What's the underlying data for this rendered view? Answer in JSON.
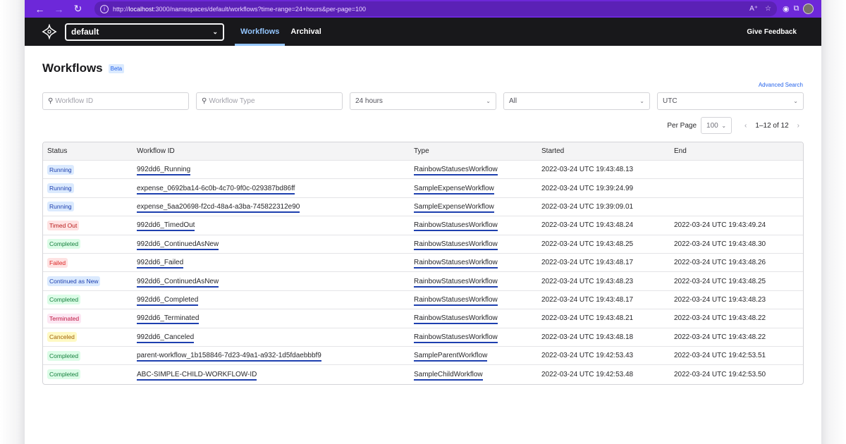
{
  "browser": {
    "url_prefix": "http://",
    "url_host": "localhost",
    "url_path": ":3000/namespaces/default/workflows?time-range=24+hours&per-page=100"
  },
  "header": {
    "namespace": "default",
    "nav": [
      {
        "label": "Workflows",
        "active": true
      },
      {
        "label": "Archival",
        "active": false
      }
    ],
    "feedback_label": "Give Feedback"
  },
  "page": {
    "title": "Workflows",
    "beta_label": "Beta",
    "advanced_search_label": "Advanced Search"
  },
  "filters": {
    "workflow_id_placeholder": "Workflow ID",
    "workflow_type_placeholder": "Workflow Type",
    "time_range": "24 hours",
    "status": "All",
    "timezone": "UTC"
  },
  "pagination": {
    "per_page_label": "Per Page",
    "per_page_value": "100",
    "range_label": "1–12 of 12"
  },
  "table": {
    "columns": [
      "Status",
      "Workflow ID",
      "Type",
      "Started",
      "End"
    ],
    "rows": [
      {
        "status": "Running",
        "status_class": "b-running",
        "id": "992dd6_Running",
        "type": "RainbowStatusesWorkflow",
        "started": "2022-03-24 UTC 19:43:48.13",
        "end": ""
      },
      {
        "status": "Running",
        "status_class": "b-running",
        "id": "expense_0692ba14-6c0b-4c70-9f0c-029387bd86ff",
        "type": "SampleExpenseWorkflow",
        "started": "2022-03-24 UTC 19:39:24.99",
        "end": ""
      },
      {
        "status": "Running",
        "status_class": "b-running",
        "id": "expense_5aa20698-f2cd-48a4-a3ba-745822312e90",
        "type": "SampleExpenseWorkflow",
        "started": "2022-03-24 UTC 19:39:09.01",
        "end": ""
      },
      {
        "status": "Timed Out",
        "status_class": "b-timedout",
        "id": "992dd6_TimedOut",
        "type": "RainbowStatusesWorkflow",
        "started": "2022-03-24 UTC 19:43:48.24",
        "end": "2022-03-24 UTC 19:43:49.24"
      },
      {
        "status": "Completed",
        "status_class": "b-completed",
        "id": "992dd6_ContinuedAsNew",
        "type": "RainbowStatusesWorkflow",
        "started": "2022-03-24 UTC 19:43:48.25",
        "end": "2022-03-24 UTC 19:43:48.30"
      },
      {
        "status": "Failed",
        "status_class": "b-failed",
        "id": "992dd6_Failed",
        "type": "RainbowStatusesWorkflow",
        "started": "2022-03-24 UTC 19:43:48.17",
        "end": "2022-03-24 UTC 19:43:48.26"
      },
      {
        "status": "Continued as New",
        "status_class": "b-continued",
        "id": "992dd6_ContinuedAsNew",
        "type": "RainbowStatusesWorkflow",
        "started": "2022-03-24 UTC 19:43:48.23",
        "end": "2022-03-24 UTC 19:43:48.25"
      },
      {
        "status": "Completed",
        "status_class": "b-completed",
        "id": "992dd6_Completed",
        "type": "RainbowStatusesWorkflow",
        "started": "2022-03-24 UTC 19:43:48.17",
        "end": "2022-03-24 UTC 19:43:48.23"
      },
      {
        "status": "Terminated",
        "status_class": "b-terminated",
        "id": "992dd6_Terminated",
        "type": "RainbowStatusesWorkflow",
        "started": "2022-03-24 UTC 19:43:48.21",
        "end": "2022-03-24 UTC 19:43:48.22"
      },
      {
        "status": "Canceled",
        "status_class": "b-canceled",
        "id": "992dd6_Canceled",
        "type": "RainbowStatusesWorkflow",
        "started": "2022-03-24 UTC 19:43:48.18",
        "end": "2022-03-24 UTC 19:43:48.22"
      },
      {
        "status": "Completed",
        "status_class": "b-completed",
        "id": "parent-workflow_1b158846-7d23-49a1-a932-1d5fdaebbbf9",
        "type": "SampleParentWorkflow",
        "started": "2022-03-24 UTC 19:42:53.43",
        "end": "2022-03-24 UTC 19:42:53.51"
      },
      {
        "status": "Completed",
        "status_class": "b-completed",
        "id": "ABC-SIMPLE-CHILD-WORKFLOW-ID",
        "type": "SampleChildWorkflow",
        "started": "2022-03-24 UTC 19:42:53.48",
        "end": "2022-03-24 UTC 19:42:53.50"
      }
    ]
  }
}
